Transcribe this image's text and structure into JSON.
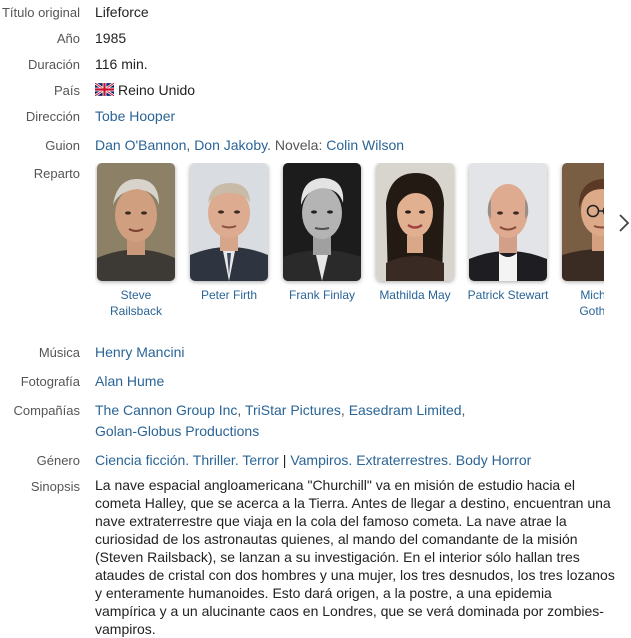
{
  "labels": {
    "original_title": "Título original",
    "year": "Año",
    "duration": "Duración",
    "country": "País",
    "director": "Dirección",
    "screenplay": "Guion",
    "cast": "Reparto",
    "music": "Música",
    "photography": "Fotografía",
    "companies": "Compañías",
    "genre": "Género",
    "synopsis": "Sinopsis"
  },
  "movie": {
    "original_title": "Lifeforce",
    "year": "1985",
    "duration": "116 min.",
    "country": "Reino Unido",
    "country_flag_icon": "uk-flag-icon",
    "director": "Tobe Hooper",
    "screenplay": {
      "writer1": "Dan O'Bannon",
      "sep1": ", ",
      "writer2": "Don Jakoby",
      "novel_prefix": ". Novela: ",
      "novelist": "Colin Wilson"
    },
    "cast": [
      {
        "name": "Steve Railsback"
      },
      {
        "name": "Peter Firth"
      },
      {
        "name": "Frank Finlay"
      },
      {
        "name": "Mathilda May"
      },
      {
        "name": "Patrick Stewart"
      },
      {
        "name": "Michael Gothard"
      }
    ],
    "music": "Henry Mancini",
    "photography": "Alan Hume",
    "companies": {
      "c1": "The Cannon Group Inc",
      "sep1": ", ",
      "c2": "TriStar Pictures",
      "sep2": ", ",
      "c3": "Easedram Limited",
      "sep3": ",",
      "c4": "Golan-Globus Productions"
    },
    "genre": {
      "g1": "Ciencia ficción",
      "d1": ". ",
      "g2": "Thriller",
      "d2": ". ",
      "g3": "Terror",
      "bar": " | ",
      "g4": "Vampiros",
      "d3": ". ",
      "g5": "Extraterrestres",
      "d4": ". ",
      "g6": "Body Horror"
    },
    "synopsis": "La nave espacial angloamericana \"Churchill\" va en misión de estudio hacia el cometa Halley, que se acerca a la Tierra. Antes de llegar a destino, encuentran una nave extraterrestre que viaja en la cola del famoso cometa. La nave atrae la curiosidad de los astronautas quienes, al mando del comandante de la misión (Steven Railsback), se lanzan a su investigación. En el interior sólo hallan tres ataudes de cristal con dos hombres y una mujer, los tres desnudos, los tres lozanos y enteramente humanoides. Esto dará origen, a la postre, a una epidemia vampírica y a un alucinante caos en Londres, que se verá dominada por zombies-vampiros."
  },
  "icons": {
    "next": "chevron-right-icon"
  },
  "colors": {
    "link": "#2a6496",
    "label": "#555555",
    "text": "#222222"
  }
}
